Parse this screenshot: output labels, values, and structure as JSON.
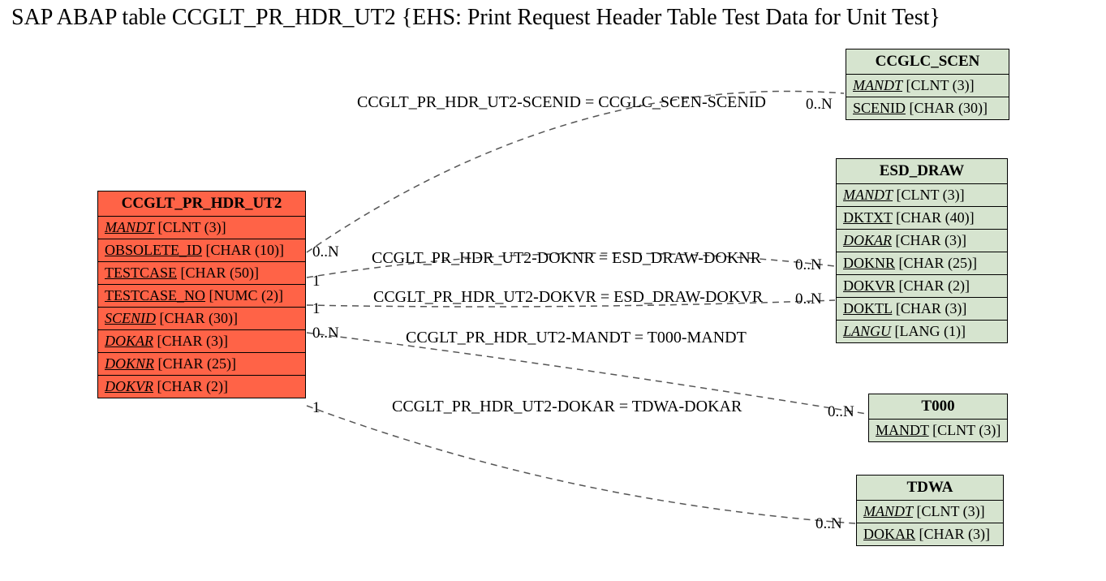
{
  "title": "SAP ABAP table CCGLT_PR_HDR_UT2 {EHS: Print Request Header Table Test Data for Unit Test}",
  "main": {
    "name": "CCGLT_PR_HDR_UT2",
    "fields": [
      {
        "name": "MANDT",
        "type": "[CLNT (3)]",
        "italic": true
      },
      {
        "name": "OBSOLETE_ID",
        "type": "[CHAR (10)]",
        "italic": false
      },
      {
        "name": "TESTCASE",
        "type": "[CHAR (50)]",
        "italic": false
      },
      {
        "name": "TESTCASE_NO",
        "type": "[NUMC (2)]",
        "italic": false
      },
      {
        "name": "SCENID",
        "type": "[CHAR (30)]",
        "italic": true
      },
      {
        "name": "DOKAR",
        "type": "[CHAR (3)]",
        "italic": true
      },
      {
        "name": "DOKNR",
        "type": "[CHAR (25)]",
        "italic": true
      },
      {
        "name": "DOKVR",
        "type": "[CHAR (2)]",
        "italic": true
      }
    ]
  },
  "related": [
    {
      "name": "CCGLC_SCEN",
      "fields": [
        {
          "name": "MANDT",
          "type": "[CLNT (3)]",
          "italic": true
        },
        {
          "name": "SCENID",
          "type": "[CHAR (30)]",
          "italic": false
        }
      ]
    },
    {
      "name": "ESD_DRAW",
      "fields": [
        {
          "name": "MANDT",
          "type": "[CLNT (3)]",
          "italic": true
        },
        {
          "name": "DKTXT",
          "type": "[CHAR (40)]",
          "italic": false
        },
        {
          "name": "DOKAR",
          "type": "[CHAR (3)]",
          "italic": true
        },
        {
          "name": "DOKNR",
          "type": "[CHAR (25)]",
          "italic": false
        },
        {
          "name": "DOKVR",
          "type": "[CHAR (2)]",
          "italic": false
        },
        {
          "name": "DOKTL",
          "type": "[CHAR (3)]",
          "italic": false
        },
        {
          "name": "LANGU",
          "type": "[LANG (1)]",
          "italic": true
        }
      ]
    },
    {
      "name": "T000",
      "fields": [
        {
          "name": "MANDT",
          "type": "[CLNT (3)]",
          "italic": false
        }
      ]
    },
    {
      "name": "TDWA",
      "fields": [
        {
          "name": "MANDT",
          "type": "[CLNT (3)]",
          "italic": true
        },
        {
          "name": "DOKAR",
          "type": "[CHAR (3)]",
          "italic": false
        }
      ]
    }
  ],
  "relations": [
    {
      "text": "CCGLT_PR_HDR_UT2-SCENID = CCGLC_SCEN-SCENID",
      "leftCard": "0..N",
      "rightCard": "0..N"
    },
    {
      "text": "CCGLT_PR_HDR_UT2-DOKNR = ESD_DRAW-DOKNR",
      "leftCard": "1",
      "rightCard": "0..N"
    },
    {
      "text": "CCGLT_PR_HDR_UT2-DOKVR = ESD_DRAW-DOKVR",
      "leftCard": "1",
      "rightCard": "0..N"
    },
    {
      "text": "CCGLT_PR_HDR_UT2-MANDT = T000-MANDT",
      "leftCard": "0..N",
      "rightCard": "0..N"
    },
    {
      "text": "CCGLT_PR_HDR_UT2-DOKAR = TDWA-DOKAR",
      "leftCard": "1",
      "rightCard": "0..N"
    }
  ]
}
